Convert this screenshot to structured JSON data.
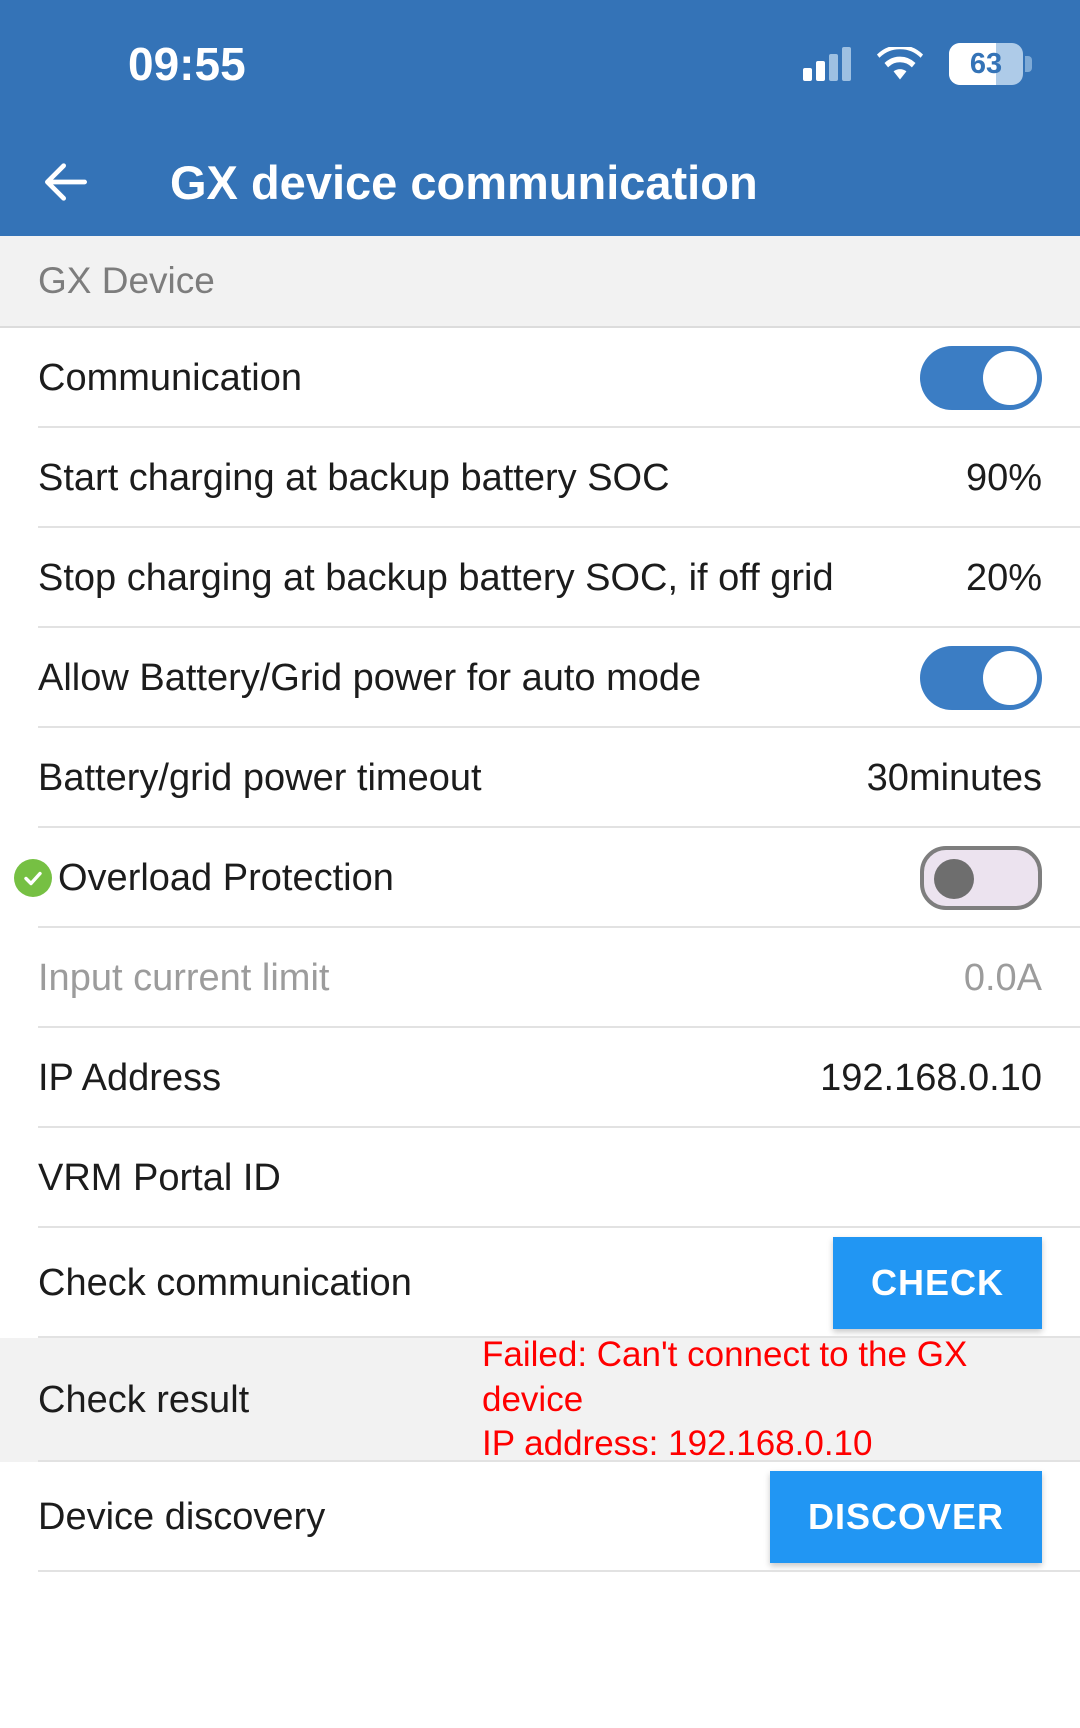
{
  "status_bar": {
    "time": "09:55",
    "battery_percent": "63",
    "signal_icon": "cellular-signal-icon",
    "wifi_icon": "wifi-icon",
    "battery_icon": "battery-icon"
  },
  "app_bar": {
    "back_icon": "back-arrow-icon",
    "title": "GX device communication"
  },
  "section": {
    "header": "GX Device"
  },
  "rows": [
    {
      "label": "Communication",
      "type": "toggle",
      "state": "on"
    },
    {
      "label": "Start charging at backup battery SOC",
      "type": "value",
      "value": "90%"
    },
    {
      "label": "Stop charging at backup battery SOC, if off grid",
      "type": "value",
      "value": "20%"
    },
    {
      "label": "Allow Battery/Grid power for auto mode",
      "type": "toggle",
      "state": "on"
    },
    {
      "label": "Battery/grid power timeout",
      "type": "value",
      "value": "30minutes"
    },
    {
      "label": "Overload Protection",
      "type": "toggle",
      "state": "off",
      "icon": "green-check-icon"
    },
    {
      "label": "Input current limit",
      "type": "value",
      "value": "0.0A",
      "disabled": true
    },
    {
      "label": "IP Address",
      "type": "value",
      "value": "192.168.0.10"
    },
    {
      "label": "VRM Portal ID",
      "type": "value",
      "value": ""
    },
    {
      "label": "Check communication",
      "type": "button",
      "button_label": "CHECK"
    },
    {
      "label": "Check result",
      "type": "result",
      "value": "Failed: Can't connect to the GX device\nIP address: 192.168.0.10"
    },
    {
      "label": "Device discovery",
      "type": "button",
      "button_label": "DISCOVER"
    }
  ],
  "colors": {
    "app_bar": "#3473b7",
    "toggle_on": "#3b7dc4",
    "button": "#2196f3",
    "error_text": "#ff0000",
    "check_badge": "#76c043",
    "section_bg": "#f2f2f2"
  }
}
